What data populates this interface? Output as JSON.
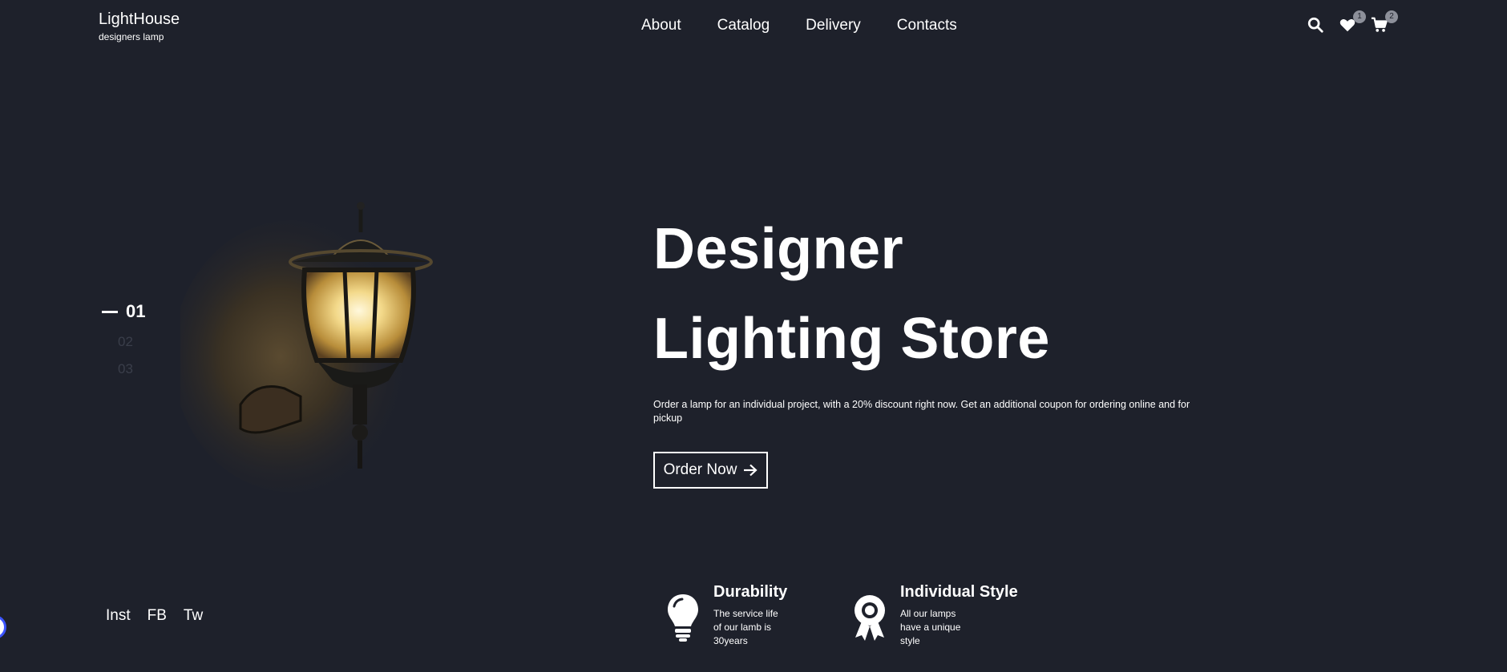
{
  "brand": {
    "title": "LightHouse",
    "subtitle": "designers lamp"
  },
  "nav": {
    "items": [
      "About",
      "Catalog",
      "Delivery",
      "Contacts"
    ]
  },
  "header_icons": {
    "search": "search-icon",
    "favorites": {
      "icon": "heart-icon",
      "count": "1"
    },
    "cart": {
      "icon": "cart-icon",
      "count": "2"
    }
  },
  "slider": {
    "active": "01",
    "others": [
      "02",
      "03"
    ]
  },
  "hero": {
    "title_line1": "Designer",
    "title_line2": "Lighting Store",
    "description": "Order a lamp for an individual project, with a 20% discount right now. Get an additional coupon for ordering online and for pickup",
    "cta_label": "Order Now"
  },
  "social": [
    "Inst",
    "FB",
    "Tw"
  ],
  "features": [
    {
      "icon": "lightbulb-icon",
      "title": "Durability",
      "text": "The service life of our lamb is 30years"
    },
    {
      "icon": "award-icon",
      "title": "Individual Style",
      "text": "All our lamps have a unique style"
    }
  ],
  "colors": {
    "background": "#1e212b",
    "text": "#ffffff",
    "badge": "#8d909a",
    "muted": "#3a3e4a"
  }
}
